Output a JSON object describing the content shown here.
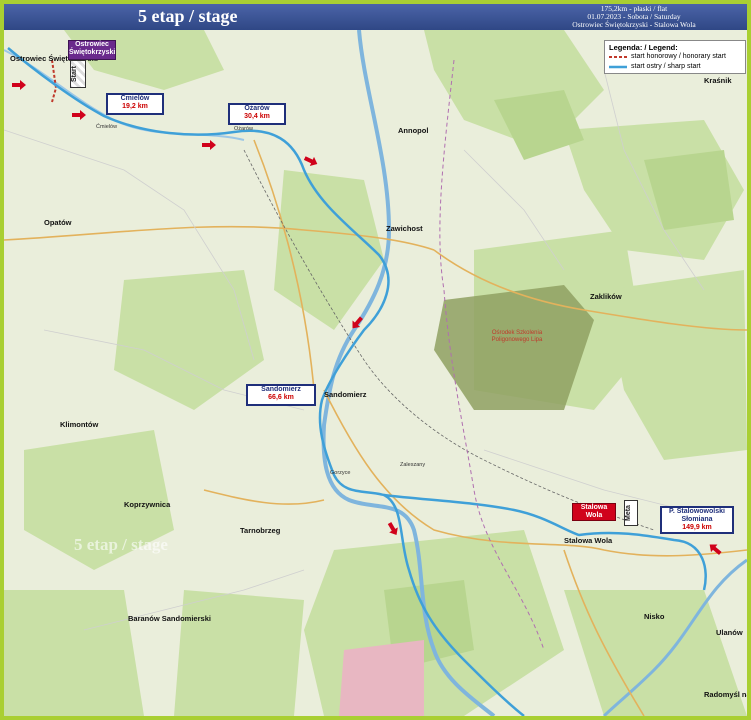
{
  "header": {
    "title": "5 etap / stage",
    "line1": "175,2km - płaski / flat",
    "line2": "01.07.2023 -  Sobota / Saturday",
    "line3": "Ostrowiec Świętokrzyski - Stalowa Wola"
  },
  "legend": {
    "title": "Legenda: / Legend:",
    "honorary": "start honorowy / honorary start",
    "sharp": "start ostry / sharp start"
  },
  "start": {
    "name": "Ostrowiec Świętokrzyski",
    "badge": "Start"
  },
  "points": [
    {
      "name": "Ćmielów",
      "km": "19,2 km"
    },
    {
      "name": "Ożarów",
      "km": "30,4 km"
    },
    {
      "name": "Sandomierz",
      "km": "66,6 km"
    },
    {
      "name": "P. Stalowowolski Słomiana",
      "km": "149,9 km"
    }
  ],
  "finish": {
    "name": "Stalowa Wola",
    "badge": "Meta"
  },
  "watermark": "5 etap / stage",
  "poligon": "Ośrodek Szkolenia Poligonowego Lipa",
  "places": {
    "ostrowiec": "Ostrowiec Świętokrzyski",
    "opatow": "Opatów",
    "annopol": "Annopol",
    "zawichost": "Zawichost",
    "sandomierz": "Sandomierz",
    "tarnobrzeg": "Tarnobrzeg",
    "stalowa": "Stalowa Wola",
    "nisko": "Nisko",
    "ulanow": "Ulanów",
    "baranow": "Baranów Sandomierski",
    "krasnik": "Kraśnik",
    "zaklikow": "Zaklików",
    "koprzywnica": "Koprzywnica",
    "klimontow": "Klimontów",
    "radomysl": "Radomyśl nad Sanem",
    "ozarow": "Ożarów",
    "cmielow": "Ćmielów",
    "zakliczyn": "Zaleszany",
    "gorzyce": "Gorzyce"
  },
  "colors": {
    "header": "#34508f",
    "route": "#3fa0d8",
    "honorary": "#c0392b",
    "frame": "#a9cf32",
    "forest": "#c7dfa3",
    "poligon": "#8a9e5b"
  }
}
